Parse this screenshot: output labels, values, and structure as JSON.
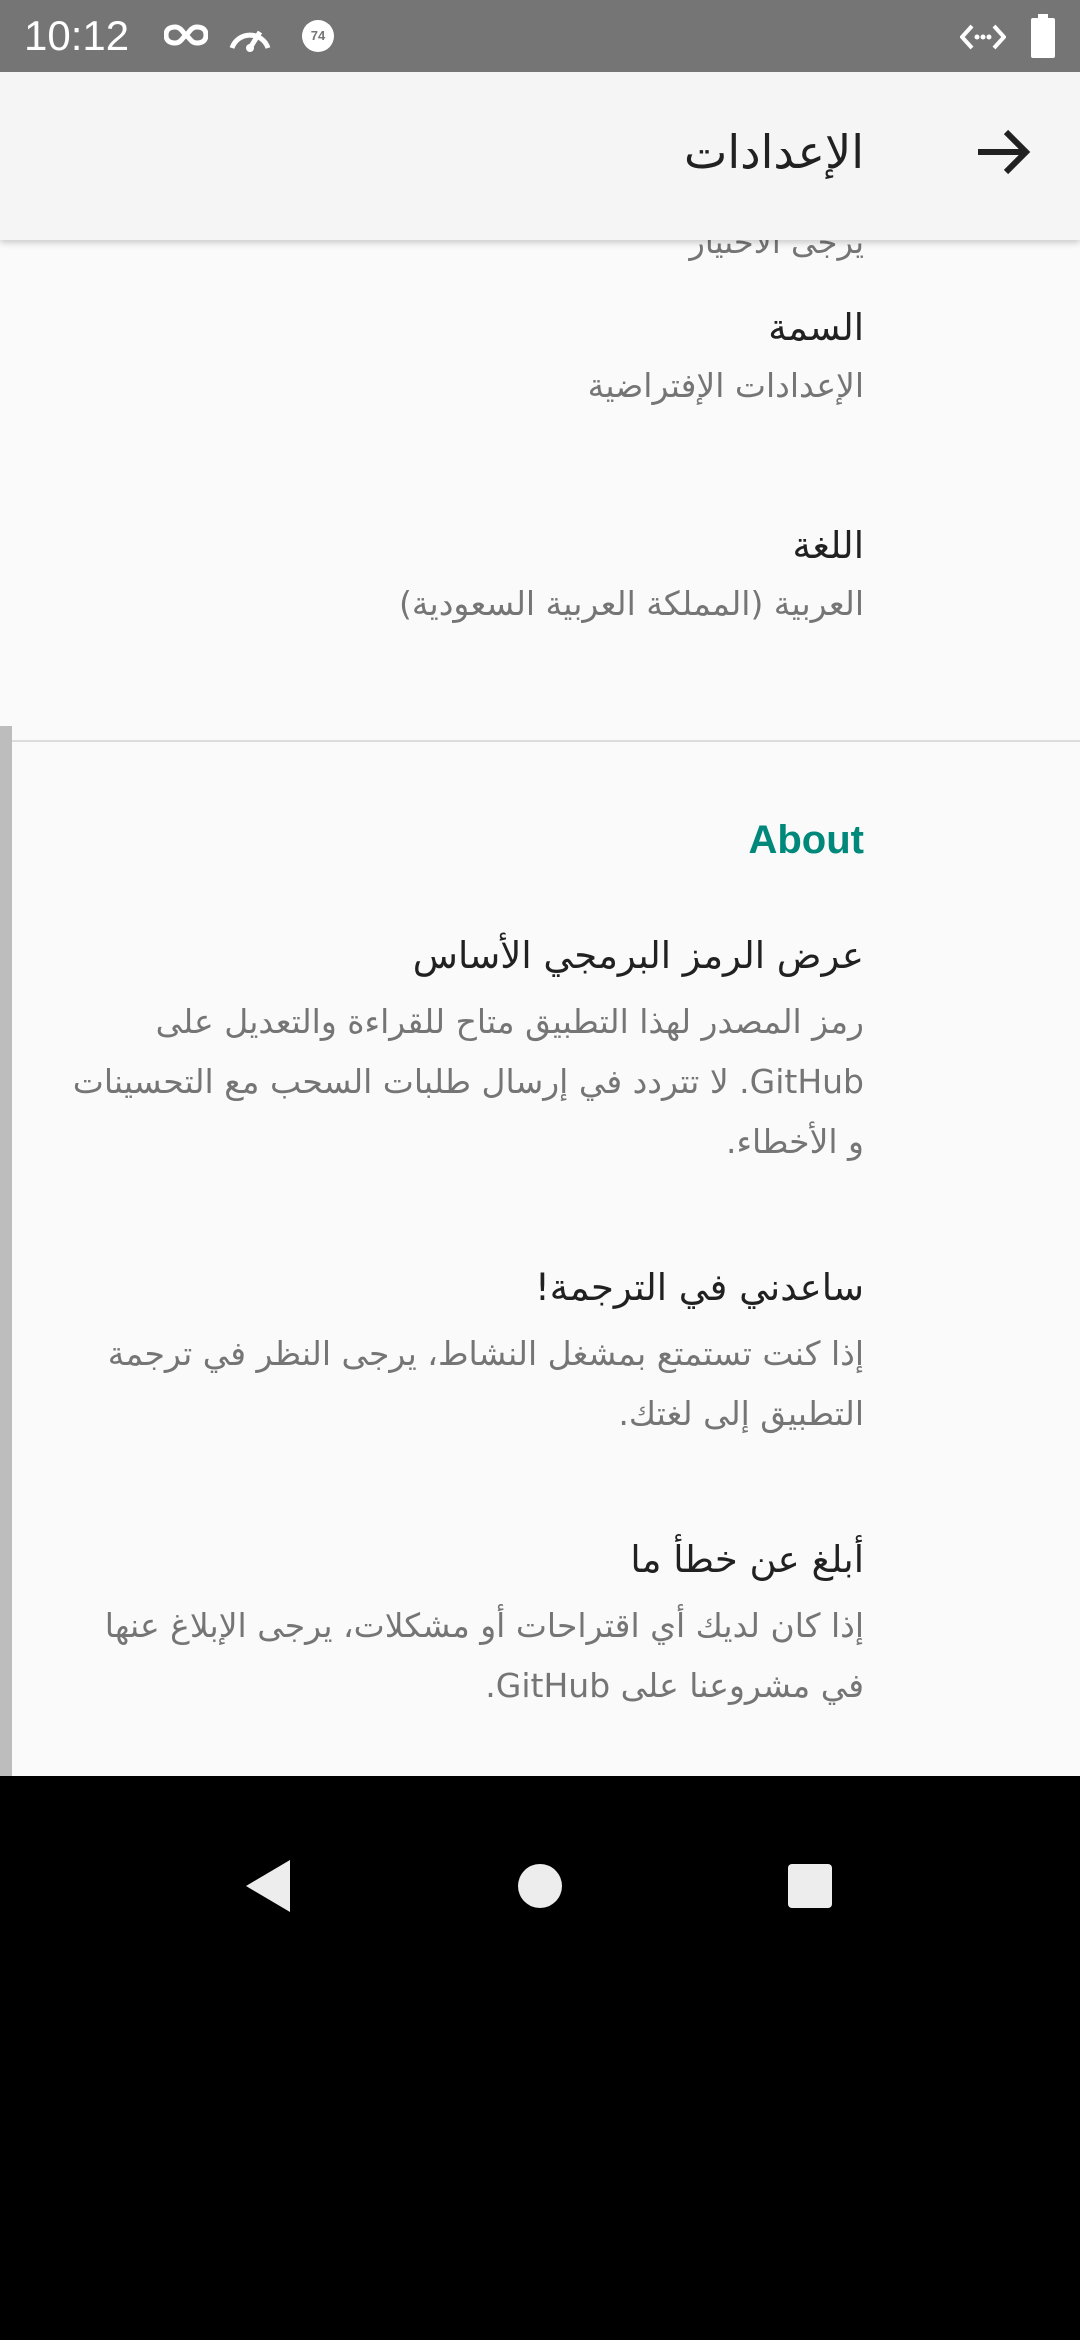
{
  "status_bar": {
    "time": "10:12",
    "badge_number": "74",
    "icons": [
      "infinity-icon",
      "speedometer-icon",
      "circle-badge-icon",
      "code-arrows-icon",
      "battery-icon"
    ]
  },
  "app_bar": {
    "title": "الإعدادات",
    "back_icon": "arrow-forward-icon"
  },
  "settings": {
    "clipped_summary": "يرجى الاختيار",
    "theme": {
      "title": "السمة",
      "summary": "الإعدادات الإفتراضية"
    },
    "language": {
      "title": "اللغة",
      "summary": "العربية (المملكة العربية السعودية)"
    }
  },
  "about": {
    "category_title": "About",
    "items": [
      {
        "title": "عرض الرمز البرمجي الأساس",
        "summary": "رمز المصدر لهذا التطبيق متاح للقراءة والتعديل على GitHub. لا تتردد في إرسال طلبات السحب مع التحسينات و الأخطاء."
      },
      {
        "title": "ساعدني في الترجمة!",
        "summary": "إذا كنت تستمتع بمشغل النشاط، يرجى النظر في ترجمة التطبيق إلى لغتك."
      },
      {
        "title": "أبلغ عن خطأ ما",
        "summary": "إذا كان لديك أي اقتراحات أو مشكلات، يرجى الإبلاغ عنها في مشروعنا على GitHub."
      }
    ]
  },
  "nav_bar": {
    "back": "nav-back-icon",
    "home": "nav-home-icon",
    "recents": "nav-recents-icon"
  },
  "colors": {
    "accent": "#00897b",
    "status_bar": "#757575",
    "app_bar": "#f5f5f5",
    "background": "#fafafa",
    "primary_text": "#212121",
    "secondary_text": "#757575"
  }
}
